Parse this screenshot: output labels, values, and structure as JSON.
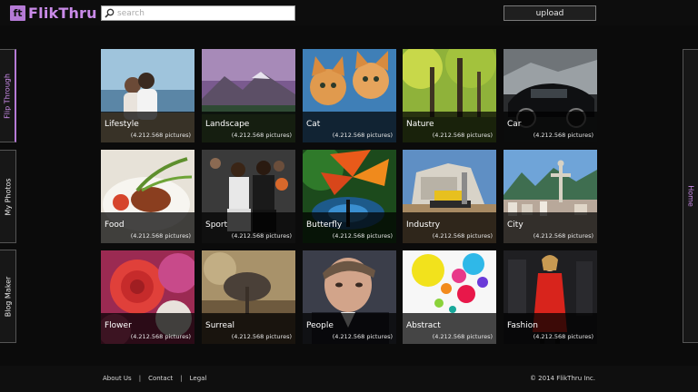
{
  "app": {
    "logo_mark": "ft",
    "name": "FlikThru"
  },
  "search": {
    "placeholder": "search",
    "value": ""
  },
  "header": {
    "upload_label": "upload"
  },
  "side_tabs": {
    "flip_through": "Flip Through",
    "my_photos": "My Photos",
    "blog_maker": "Blog Maker",
    "home": "Home"
  },
  "colors": {
    "accent": "#b57ad6"
  },
  "categories": [
    {
      "name": "Lifestyle",
      "count": "(4.212.568 pictures)"
    },
    {
      "name": "Landscape",
      "count": "(4.212.568 pictures)"
    },
    {
      "name": "Cat",
      "count": "(4.212.568 pictures)"
    },
    {
      "name": "Nature",
      "count": "(4.212.568 pictures)"
    },
    {
      "name": "Car",
      "count": "(4.212.568 pictures)"
    },
    {
      "name": "Food",
      "count": "(4.212.568 pictures)"
    },
    {
      "name": "Sport",
      "count": "(4.212.568 pictures)"
    },
    {
      "name": "Butterfly",
      "count": "(4.212.568 pictures)"
    },
    {
      "name": "Industry",
      "count": "(4.212.568 pictures)"
    },
    {
      "name": "City",
      "count": "(4.212.568 pictures)"
    },
    {
      "name": "Flower",
      "count": "(4.212.568 pictures)"
    },
    {
      "name": "Surreal",
      "count": "(4.212.568 pictures)"
    },
    {
      "name": "People",
      "count": "(4.212.568 pictures)"
    },
    {
      "name": "Abstract",
      "count": "(4.212.568 pictures)"
    },
    {
      "name": "Fashion",
      "count": "(4.212.568 pictures)"
    }
  ],
  "footer": {
    "about": "About Us",
    "contact": "Contact",
    "legal": "Legal",
    "separator": "|",
    "copyright": "© 2014 FlikThru Inc."
  }
}
